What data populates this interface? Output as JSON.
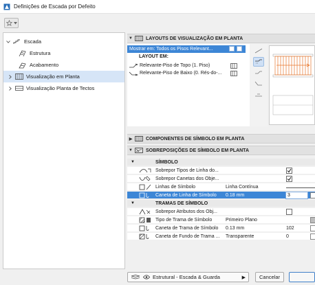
{
  "window": {
    "title": "Definições de Escada por Defeito"
  },
  "tree": {
    "items": [
      {
        "label": "Escada"
      },
      {
        "label": "Estrutura"
      },
      {
        "label": "Acabamento"
      },
      {
        "label": "Visualização em Planta"
      },
      {
        "label": "Visualização Planta de Tectos"
      }
    ]
  },
  "sections": {
    "layouts": {
      "title": "LAYOUTS DE VISUALIZAÇÃO EM PLANTA"
    },
    "componentes": {
      "title": "COMPONENTES DE SÍMBOLO EM PLANTA"
    },
    "sobreposicoes": {
      "title": "SOBREPOSIÇÕES DE SÍMBOLO EM PLANTA"
    }
  },
  "layouts": {
    "show_on": "Mostrar em: Todos os Pisos Relevant...",
    "layout_em": "LAYOUT EM:",
    "rows": [
      {
        "label": "Relevante-Piso de Topo (1. Piso)"
      },
      {
        "label": "Relevante-Piso de Baixo (0. Rés-do-..."
      }
    ]
  },
  "grid": {
    "simbolo_header": "SÍMBOLO",
    "rows": [
      {
        "label": "Sobrepor Tipos de Linha do...",
        "checked": true
      },
      {
        "label": "Sobrepor Canetas dos Obje...",
        "checked": true
      },
      {
        "label": "Linhas de Símbolo",
        "value": "Linha Contínua"
      },
      {
        "label": "Caneta de Linha de Símbolo",
        "value": "0.18 mm",
        "number": "3"
      }
    ],
    "tramas_header": "TRAMAS DE SÍMBOLO",
    "tramas_rows": [
      {
        "label": "Sobrepor Atributos dos Obj...",
        "checked": false
      },
      {
        "label": "Tipo de Trama de Símbolo",
        "value": "Primeiro Plano"
      },
      {
        "label": "Caneta de Trama de Símbolo",
        "value": "0.13 mm",
        "number": "102"
      },
      {
        "label": "Caneta de Fundo de Trama ...",
        "value": "Transparente",
        "number": "0"
      }
    ]
  },
  "footer": {
    "favorite": "Estrutural - Escada & Guarda",
    "cancel": "Cancelar"
  },
  "colors": {
    "selection": "#3d86d6",
    "tree_selection": "#d6e5f7",
    "stair_orange": "#e8772e"
  }
}
